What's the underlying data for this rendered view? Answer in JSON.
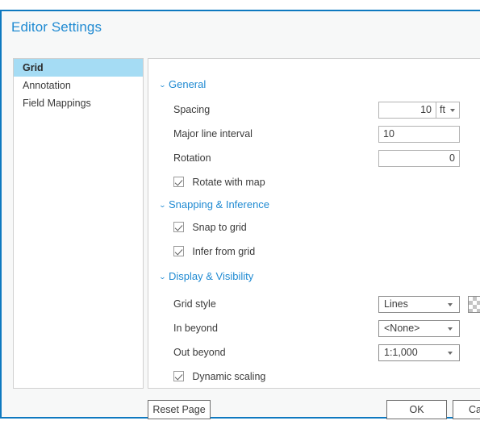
{
  "window": {
    "title": "Editor Settings",
    "accent_color": "#1f8ad2",
    "border_color": "#0e79c0"
  },
  "sidebar": {
    "items": [
      {
        "label": "Grid",
        "selected": true
      },
      {
        "label": "Annotation",
        "selected": false
      },
      {
        "label": "Field Mappings",
        "selected": false
      }
    ],
    "selected_highlight": "#a5dcf4"
  },
  "sections": {
    "general": {
      "title": "General",
      "chevron": "⌄",
      "spacing": {
        "label": "Spacing",
        "value": "10",
        "unit": "ft",
        "unit_caret": "caret-down-icon"
      },
      "major_line_interval": {
        "label": "Major line interval",
        "value": "10"
      },
      "rotation": {
        "label": "Rotation",
        "value": "0"
      },
      "rotate_with_map": {
        "label": "Rotate with map",
        "checked": true
      }
    },
    "snapping": {
      "title": "Snapping & Inference",
      "chevron": "⌄",
      "snap_to_grid": {
        "label": "Snap to grid",
        "checked": true
      },
      "infer_from_grid": {
        "label": "Infer from grid",
        "checked": true
      }
    },
    "display": {
      "title": "Display & Visibility",
      "chevron": "⌄",
      "grid_style": {
        "label": "Grid style",
        "value": "Lines",
        "swatch": "transparent-checker-swatch"
      },
      "in_beyond": {
        "label": "In beyond",
        "value": "<None>"
      },
      "out_beyond": {
        "label": "Out beyond",
        "value": "1:1,000"
      },
      "dynamic_scaling": {
        "label": "Dynamic scaling",
        "checked": true
      }
    }
  },
  "footer": {
    "reset_page": "Reset Page",
    "ok": "OK",
    "cancel": "Cancel"
  }
}
